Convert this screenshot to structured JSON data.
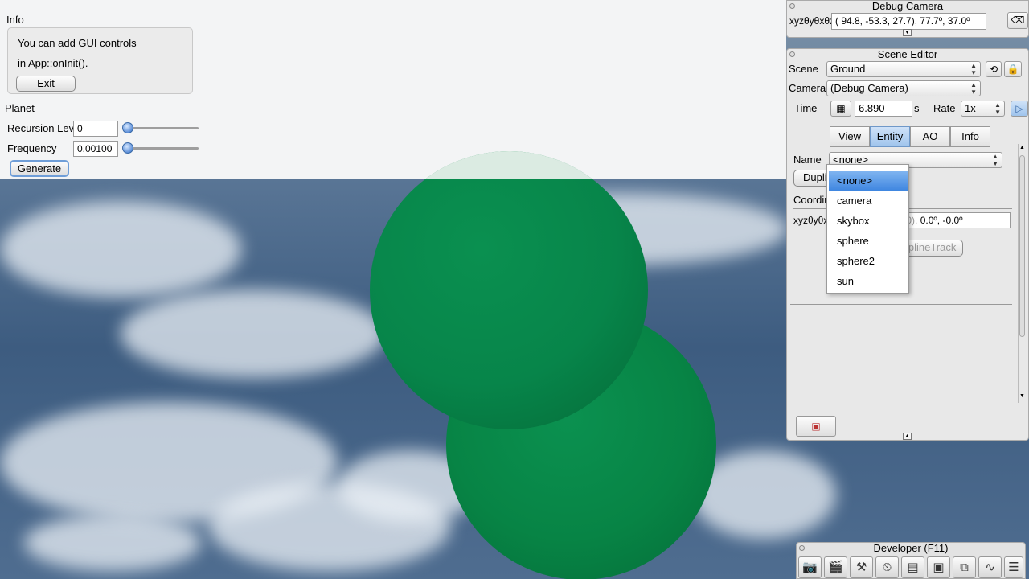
{
  "info_panel": {
    "title": "Info",
    "line1": "You can add GUI controls",
    "line2": "in App::onInit().",
    "exit_label": "Exit"
  },
  "planet_panel": {
    "title": "Planet",
    "recursion_label": "Recursion Leve",
    "recursion_value": "0",
    "recursion_slider_fraction": 0.0,
    "frequency_label": "Frequency",
    "frequency_value": "0.00100",
    "frequency_slider_fraction": 0.0,
    "generate_label": "Generate"
  },
  "debug_camera": {
    "title": "Debug Camera",
    "xyz_label": "xyzθyθxθz",
    "coords": "( 94.8, -53.3,  27.7),  77.7º,  37.0º"
  },
  "scene_editor": {
    "title": "Scene Editor",
    "scene_label": "Scene",
    "scene_value": "Ground",
    "camera_label": "Camera",
    "camera_value": "(Debug Camera)",
    "time_label": "Time",
    "time_value": "6.890",
    "time_unit": "s",
    "rate_label": "Rate",
    "rate_value": "1x",
    "tabs": [
      {
        "label": "View"
      },
      {
        "label": "Entity"
      },
      {
        "label": "AO"
      },
      {
        "label": "Info"
      }
    ],
    "name_label": "Name",
    "name_value": "<none>",
    "duplicate_label": "Dupli",
    "coordinates_label": "Coordin",
    "entity_xyz_label": "xyzθyθx",
    "entity_coords_a": "0.0,   0.0),",
    "entity_coords_b": "0.0º,  -0.0º",
    "spline_label": "Convert to SplineTrack",
    "name_options": [
      "<none>",
      "camera",
      "skybox",
      "sphere",
      "sphere2",
      "sun"
    ]
  },
  "developer_bar": {
    "title": "Developer (F11)",
    "buttons": [
      {
        "icon": "camera-icon",
        "glyph": "📷"
      },
      {
        "icon": "clapperboard-icon",
        "glyph": "🎬"
      },
      {
        "icon": "tools-icon",
        "glyph": "⚒"
      },
      {
        "icon": "clock-icon",
        "glyph": "⏲"
      },
      {
        "icon": "note-icon",
        "glyph": "▤"
      },
      {
        "icon": "terminal-icon",
        "glyph": "▣"
      },
      {
        "icon": "windows-icon",
        "glyph": "⧉"
      },
      {
        "icon": "profiler-icon",
        "glyph": "∿"
      },
      {
        "icon": "document-icon",
        "glyph": "☰"
      }
    ]
  },
  "colors": {
    "sphere_green": "#078445",
    "accent_blue": "#3f86e0"
  }
}
